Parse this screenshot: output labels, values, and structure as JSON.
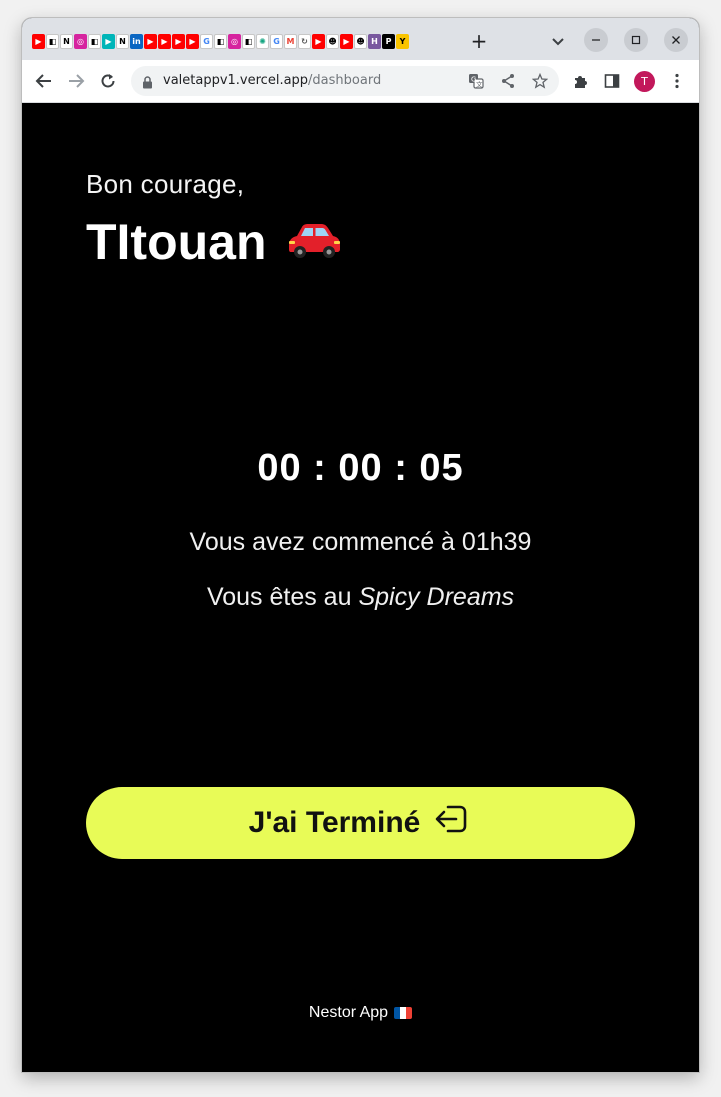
{
  "browser": {
    "favicons": [
      {
        "name": "youtube-favicon",
        "color": "#ff0000",
        "glyph": "▶"
      },
      {
        "name": "capcut-favicon",
        "color": "#ffffff",
        "glyph": "◧",
        "fg": "#000"
      },
      {
        "name": "notion-favicon",
        "color": "#ffffff",
        "glyph": "N",
        "fg": "#000"
      },
      {
        "name": "instagram-favicon",
        "color": "#d6249f",
        "glyph": "◎"
      },
      {
        "name": "capcut-favicon",
        "color": "#ffffff",
        "glyph": "◧",
        "fg": "#000"
      },
      {
        "name": "play-favicon",
        "color": "#00b5b8",
        "glyph": "▶"
      },
      {
        "name": "notion-favicon",
        "color": "#ffffff",
        "glyph": "N",
        "fg": "#000"
      },
      {
        "name": "linkedin-favicon",
        "color": "#0a66c2",
        "glyph": "in"
      },
      {
        "name": "youtube-favicon",
        "color": "#ff0000",
        "glyph": "▶"
      },
      {
        "name": "youtube-favicon",
        "color": "#ff0000",
        "glyph": "▶"
      },
      {
        "name": "youtube-favicon",
        "color": "#ff0000",
        "glyph": "▶"
      },
      {
        "name": "youtube-favicon",
        "color": "#ff0000",
        "glyph": "▶"
      },
      {
        "name": "google-favicon",
        "color": "#ffffff",
        "glyph": "G",
        "fg": "#4285f4"
      },
      {
        "name": "capcut-favicon",
        "color": "#ffffff",
        "glyph": "◧",
        "fg": "#000"
      },
      {
        "name": "instagram-favicon",
        "color": "#d6249f",
        "glyph": "◎"
      },
      {
        "name": "capcut-favicon",
        "color": "#ffffff",
        "glyph": "◧",
        "fg": "#000"
      },
      {
        "name": "chatgpt-favicon",
        "color": "#ffffff",
        "glyph": "✺",
        "fg": "#10a37f"
      },
      {
        "name": "google-favicon",
        "color": "#ffffff",
        "glyph": "G",
        "fg": "#4285f4"
      },
      {
        "name": "gmail-favicon",
        "color": "#ffffff",
        "glyph": "M",
        "fg": "#ea4335"
      },
      {
        "name": "sync-favicon",
        "color": "#ffffff",
        "glyph": "↻",
        "fg": "#555"
      },
      {
        "name": "youtube-favicon",
        "color": "#ff0000",
        "glyph": "▶"
      },
      {
        "name": "person-favicon",
        "color": "#ffffff",
        "glyph": "☻",
        "fg": "#000"
      },
      {
        "name": "youtube-favicon",
        "color": "#ff0000",
        "glyph": "▶"
      },
      {
        "name": "person-favicon",
        "color": "#ffffff",
        "glyph": "☻",
        "fg": "#000"
      },
      {
        "name": "heroku-favicon",
        "color": "#79589f",
        "glyph": "H"
      },
      {
        "name": "p-favicon",
        "color": "#000000",
        "glyph": "P"
      },
      {
        "name": "yc-favicon",
        "color": "#f9c400",
        "glyph": "Y",
        "fg": "#000"
      }
    ],
    "url_host": "valetappv1.vercel.app",
    "url_path": "/dashboard",
    "avatar_initial": "T"
  },
  "page": {
    "greeting": "Bon courage,",
    "username": "TItouan",
    "username_emoji": "car",
    "timer": "00 : 00 : 05",
    "started_text": "Vous avez commencé à 01h39",
    "location_prefix": "Vous êtes au ",
    "location_name": "Spicy Dreams",
    "done_button_label": "J'ai Terminé",
    "footer_text": "Nestor App",
    "accent_color": "#e8fb57"
  }
}
